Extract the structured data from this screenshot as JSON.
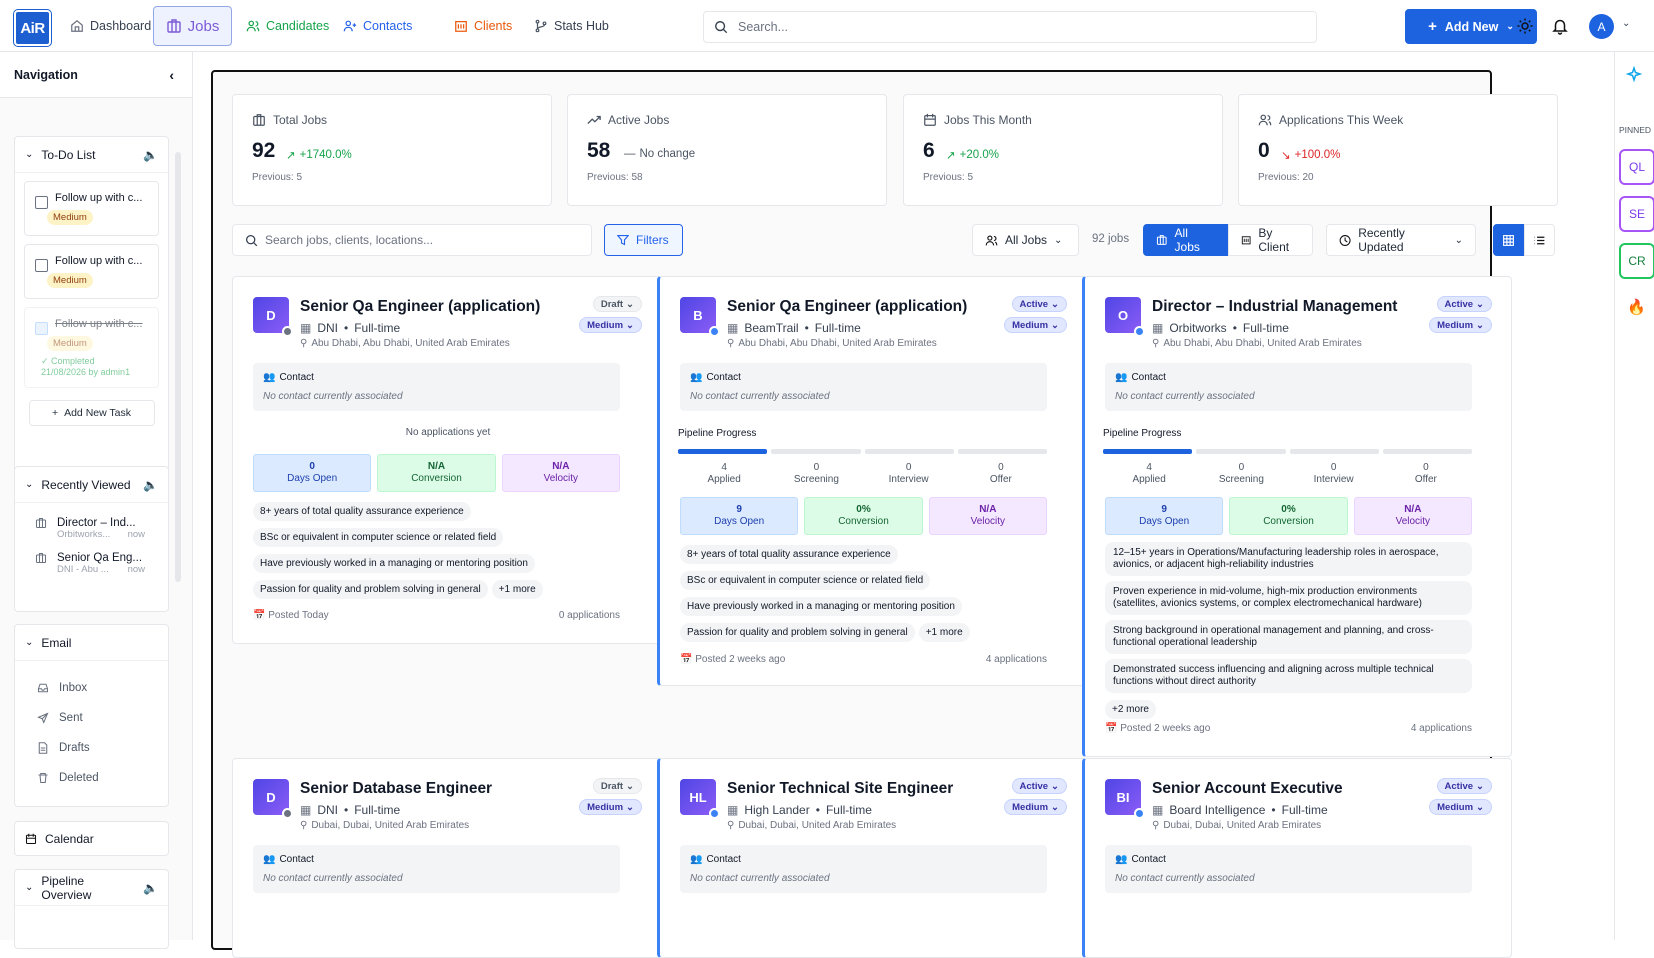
{
  "app": {
    "logo": "AiR"
  },
  "nav": {
    "tabs": [
      {
        "label": "Dashboard"
      },
      {
        "label": "Jobs"
      },
      {
        "label": "Candidates"
      },
      {
        "label": "Contacts"
      },
      {
        "label": "Clients"
      },
      {
        "label": "Stats Hub"
      }
    ]
  },
  "search": {
    "placeholder": "Search..."
  },
  "header": {
    "add_new": "Add New",
    "avatar": "A"
  },
  "sidebar": {
    "title": "Navigation",
    "todo": {
      "title": "To-Do List",
      "items": [
        {
          "text": "Follow up with c...",
          "priority": "Medium"
        },
        {
          "text": "Follow up with c...",
          "priority": "Medium"
        },
        {
          "text": "Follow up with c...",
          "priority": "Medium",
          "status": "Completed",
          "completed_meta": "21/08/2026 by admin1"
        }
      ],
      "add": "Add New Task"
    },
    "recent": {
      "title": "Recently Viewed",
      "items": [
        {
          "title": "Director – Ind...",
          "sub": "Orbitworks...",
          "time": "now"
        },
        {
          "title": "Senior Qa Eng...",
          "sub": "DNI - Abu ...",
          "time": "now"
        }
      ]
    },
    "email": {
      "title": "Email",
      "items": [
        "Inbox",
        "Sent",
        "Drafts",
        "Deleted"
      ]
    },
    "calendar": "Calendar",
    "pipeline": "Pipeline Overview"
  },
  "stats": [
    {
      "label": "Total Jobs",
      "value": "92",
      "change": "+1740.0%",
      "prev": "Previous: 5",
      "trend": "up"
    },
    {
      "label": "Active Jobs",
      "value": "58",
      "change": "No change",
      "prev": "Previous: 58",
      "trend": "flat"
    },
    {
      "label": "Jobs This Month",
      "value": "6",
      "change": "+20.0%",
      "prev": "Previous: 5",
      "trend": "up"
    },
    {
      "label": "Applications This Week",
      "value": "0",
      "change": "+100.0%",
      "prev": "Previous: 20",
      "trend": "down"
    }
  ],
  "toolbar": {
    "search_placeholder": "Search jobs, clients, locations...",
    "filters": "Filters",
    "all_jobs_filter": "All Jobs",
    "count": "92 jobs",
    "view_all": "All Jobs",
    "view_client": "By Client",
    "sort": "Recently Updated"
  },
  "cards": [
    {
      "initials": "D",
      "title": "Senior Qa Engineer (application)",
      "client": "DNI",
      "type": "Full-time",
      "location": "Abu Dhabi, Abu Dhabi, United Arab Emirates",
      "status": "Draft",
      "priority": "Medium",
      "contact_label": "Contact",
      "contact_empty": "No contact currently associated",
      "no_apps": "No applications yet",
      "days": "0",
      "days_label": "Days Open",
      "conv": "N/A",
      "conv_label": "Conversion",
      "vel": "N/A",
      "vel_label": "Velocity",
      "reqs": [
        "8+ years of total quality assurance experience",
        "BSc or equivalent in computer science or related field",
        "Have previously worked in a managing or mentoring position",
        "Passion for quality and problem solving in general"
      ],
      "more": "+1 more",
      "posted": "Posted Today",
      "apps": "0 applications"
    },
    {
      "initials": "B",
      "title": "Senior Qa Engineer (application)",
      "client": "BeamTrail",
      "type": "Full-time",
      "location": "Abu Dhabi, Abu Dhabi, United Arab Emirates",
      "status": "Active",
      "priority": "Medium",
      "contact_label": "Contact",
      "contact_empty": "No contact currently associated",
      "pipeline_title": "Pipeline Progress",
      "pipeline": [
        {
          "n": "4",
          "l": "Applied"
        },
        {
          "n": "0",
          "l": "Screening"
        },
        {
          "n": "0",
          "l": "Interview"
        },
        {
          "n": "0",
          "l": "Offer"
        }
      ],
      "days": "9",
      "days_label": "Days Open",
      "conv": "0%",
      "conv_label": "Conversion",
      "vel": "N/A",
      "vel_label": "Velocity",
      "reqs": [
        "8+ years of total quality assurance experience",
        "BSc or equivalent in computer science or related field",
        "Have previously worked in a managing or mentoring position",
        "Passion for quality and problem solving in general"
      ],
      "more": "+1 more",
      "posted": "Posted 2 weeks ago",
      "apps": "4 applications"
    },
    {
      "initials": "O",
      "title": "Director – Industrial Management",
      "client": "Orbitworks",
      "type": "Full-time",
      "location": "Abu Dhabi, Abu Dhabi, United Arab Emirates",
      "status": "Active",
      "priority": "Medium",
      "contact_label": "Contact",
      "contact_empty": "No contact currently associated",
      "pipeline_title": "Pipeline Progress",
      "pipeline": [
        {
          "n": "4",
          "l": "Applied"
        },
        {
          "n": "0",
          "l": "Screening"
        },
        {
          "n": "0",
          "l": "Interview"
        },
        {
          "n": "0",
          "l": "Offer"
        }
      ],
      "days": "9",
      "days_label": "Days Open",
      "conv": "0%",
      "conv_label": "Conversion",
      "vel": "N/A",
      "vel_label": "Velocity",
      "reqs": [
        "12–15+ years in Operations/Manufacturing leadership roles in aerospace, avionics, or adjacent high-reliability industries",
        "Proven experience in mid-volume, high-mix production environments (satellites, avionics systems, or complex electromechanical hardware)",
        "Strong background in operational management and planning, and cross-functional operational leadership",
        "Demonstrated success influencing and aligning across multiple technical functions without direct authority"
      ],
      "more": "+2 more",
      "posted": "Posted 2 weeks ago",
      "apps": "4 applications"
    },
    {
      "initials": "D",
      "title": "Senior Database Engineer",
      "client": "DNI",
      "type": "Full-time",
      "location": "Dubai, Dubai, United Arab Emirates",
      "status": "Draft",
      "priority": "Medium",
      "contact_label": "Contact",
      "contact_empty": "No contact currently associated"
    },
    {
      "initials": "HL",
      "title": "Senior Technical Site Engineer",
      "client": "High Lander",
      "type": "Full-time",
      "location": "Dubai, Dubai, United Arab Emirates",
      "status": "Active",
      "priority": "Medium",
      "contact_label": "Contact",
      "contact_empty": "No contact currently associated"
    },
    {
      "initials": "BI",
      "title": "Senior Account Executive",
      "client": "Board Intelligence",
      "type": "Full-time",
      "location": "Dubai, Dubai, United Arab Emirates",
      "status": "Active",
      "priority": "Medium",
      "contact_label": "Contact",
      "contact_empty": "No contact currently associated"
    }
  ],
  "right": {
    "pinned_label": "PINNED",
    "pins": [
      "QL",
      "SE",
      "CR"
    ]
  },
  "colors": {
    "accent": "#1d63e0",
    "green": "#16a34a",
    "red": "#dc2626",
    "purple": "#7c3aed"
  }
}
